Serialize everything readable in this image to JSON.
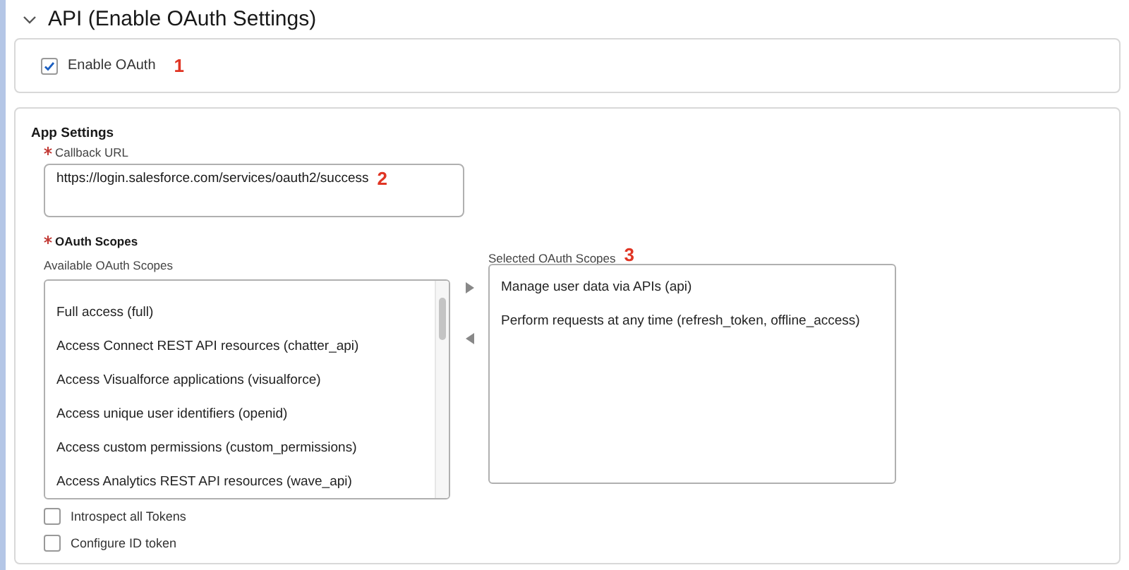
{
  "section": {
    "title": "API (Enable OAuth Settings)",
    "expanded": true
  },
  "enable_oauth": {
    "label": "Enable OAuth",
    "checked": true,
    "annotation": "1"
  },
  "app_settings": {
    "title": "App Settings",
    "callback_url": {
      "label": "Callback URL",
      "required": true,
      "value": "https://login.salesforce.com/services/oauth2/success",
      "annotation": "2"
    },
    "oauth_scopes": {
      "label": "OAuth Scopes",
      "required": true,
      "available": {
        "label": "Available OAuth Scopes",
        "items": [
          "Full access (full)",
          "Access Connect REST API resources (chatter_api)",
          "Access Visualforce applications (visualforce)",
          "Access unique user identifiers (openid)",
          "Access custom permissions (custom_permissions)",
          "Access Analytics REST API resources (wave_api)"
        ]
      },
      "selected": {
        "label": "Selected OAuth Scopes",
        "annotation": "3",
        "items": [
          "Manage user data via APIs (api)",
          "Perform requests at any time (refresh_token, offline_access)"
        ]
      }
    },
    "options": [
      {
        "label": "Introspect all Tokens",
        "checked": false
      },
      {
        "label": "Configure ID token",
        "checked": false
      }
    ]
  }
}
